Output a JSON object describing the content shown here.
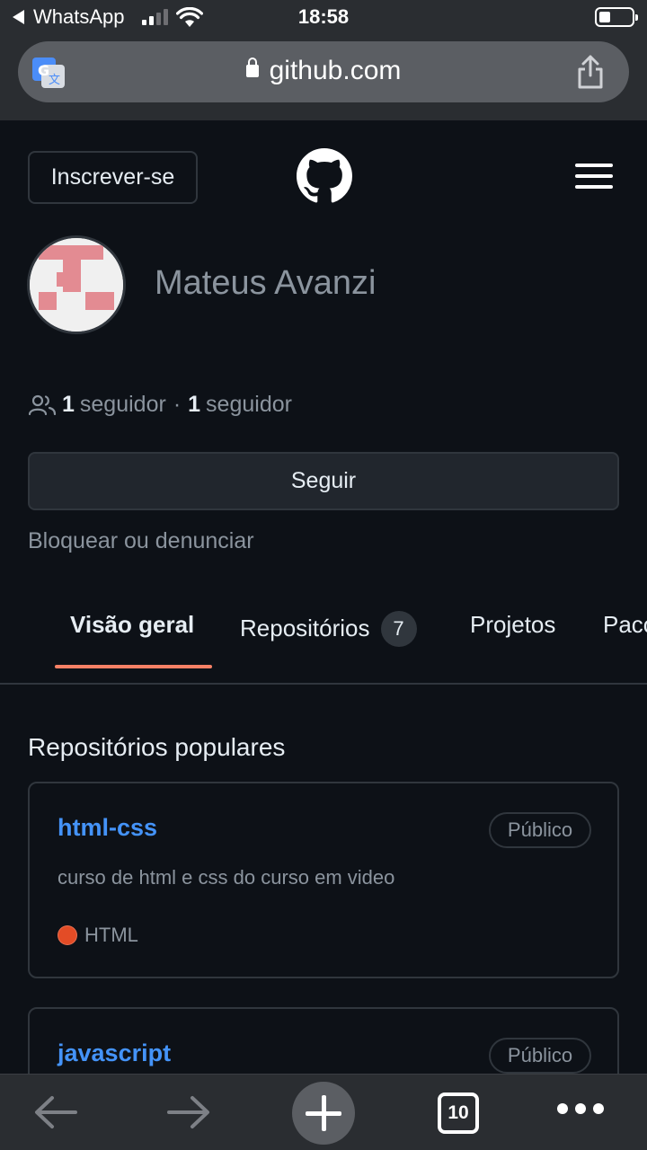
{
  "status_bar": {
    "back_app": "WhatsApp",
    "time": "18:58"
  },
  "browser": {
    "url": "github.com",
    "open_tabs": "10"
  },
  "header": {
    "signup_label": "Inscrever-se"
  },
  "profile": {
    "name": "Mateus Avanzi",
    "followers_count": "1",
    "followers_label": "seguidor",
    "following_count": "1",
    "following_label": "seguidor",
    "separator": "·",
    "follow_label": "Seguir",
    "block_label": "Bloquear ou denunciar"
  },
  "tabs": [
    {
      "label": "Visão geral",
      "active": true
    },
    {
      "label": "Repositórios",
      "count": "7"
    },
    {
      "label": "Projetos"
    },
    {
      "label": "Pacotes"
    }
  ],
  "popular": {
    "title": "Repositórios populares",
    "repos": [
      {
        "name": "html-css",
        "visibility": "Público",
        "description": "curso de html e css do curso em video",
        "language": "HTML",
        "language_color": "#e34c26"
      },
      {
        "name": "javascript",
        "visibility": "Público"
      }
    ]
  },
  "colors": {
    "background": "#0d1117",
    "accent_underline": "#f78166",
    "link": "#4493f8"
  }
}
